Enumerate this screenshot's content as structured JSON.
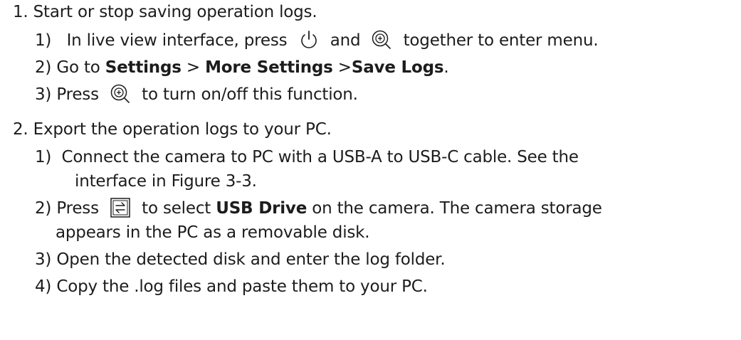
{
  "step1": {
    "title": "1. Start or stop saving operation logs.",
    "s1": {
      "num": "1)",
      "a": "In live view interface, press",
      "b": "and",
      "c": "together to enter menu.",
      "icon1": "power-icon",
      "icon2": "zoom-in-icon"
    },
    "s2": {
      "num": "2)",
      "a": "Go to",
      "b1": "Settings",
      "c": ">",
      "b2": "More Settings",
      "d": ">",
      "b3": "Save Logs",
      "e": "."
    },
    "s3": {
      "num": "3)",
      "a": "Press",
      "b": "to turn on/off this function.",
      "icon": "zoom-in-icon"
    }
  },
  "step2": {
    "title": "2. Export the operation logs to your PC.",
    "s1": {
      "num": "1)",
      "line1": "Connect the camera to PC with a USB-A to USB-C cable. See the",
      "line2": "interface in Figure 3-3."
    },
    "s2": {
      "num": "2)",
      "a": "Press",
      "b": "to select",
      "bold": "USB Drive",
      "c": "on the camera. The camera storage",
      "line2": "appears in the PC as a removable disk.",
      "icon": "mode-switch-icon"
    },
    "s3": {
      "num": "3)",
      "text": "Open the detected disk and enter the log folder."
    },
    "s4": {
      "num": "4)",
      "text": "Copy the .log files and paste them to your PC."
    }
  }
}
